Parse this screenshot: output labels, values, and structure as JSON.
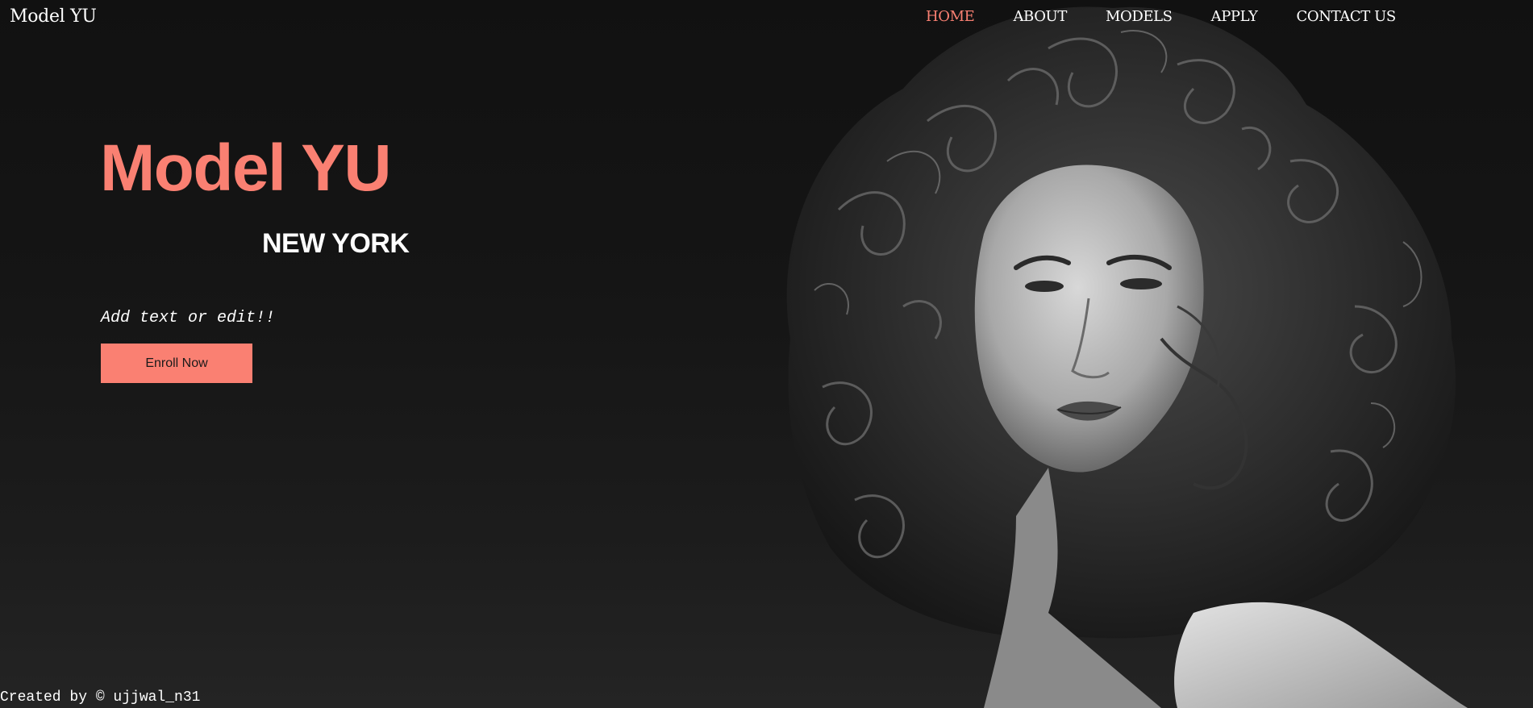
{
  "header": {
    "brand": "Model YU",
    "nav": [
      {
        "label": "HOME",
        "active": true
      },
      {
        "label": "ABOUT",
        "active": false
      },
      {
        "label": "MODELS",
        "active": false
      },
      {
        "label": "APPLY",
        "active": false
      },
      {
        "label": "CONTACT US",
        "active": false
      }
    ]
  },
  "hero": {
    "title": "Model YU",
    "subtitle": "NEW YORK",
    "note": "Add text or edit!!",
    "cta_label": "Enroll Now"
  },
  "footer": {
    "credit": "Created by © ujjwal_n31"
  },
  "colors": {
    "accent": "#fa8072",
    "background": "#121212",
    "text": "#ffffff"
  }
}
